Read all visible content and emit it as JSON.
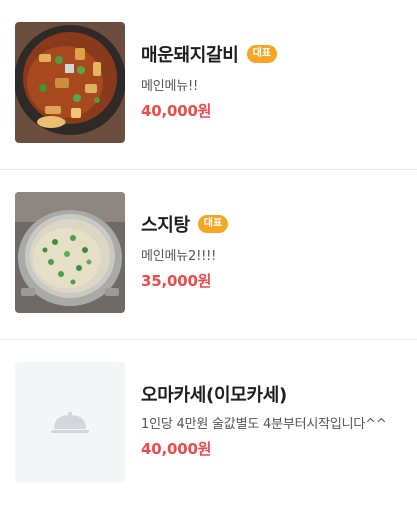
{
  "menu": {
    "items": [
      {
        "name": "매운돼지갈비",
        "badge": "대표",
        "description": "메인메뉴!!",
        "price": "40,000원",
        "image": "spicy-pork-rib-stew-photo"
      },
      {
        "name": "스지탕",
        "badge": "대표",
        "description": "메인메뉴2!!!!",
        "price": "35,000원",
        "image": "beef-tendon-soup-photo"
      },
      {
        "name": "오마카세(이모카세)",
        "description": "1인당 4만원 술값별도 4분부터시작입니다^^",
        "price": "40,000원",
        "image": "cloche-placeholder-icon"
      }
    ]
  },
  "colors": {
    "badge": "#f5a623",
    "price": "#f04a4a",
    "divider": "#ececec",
    "placeholder_bg": "#f4f5f7"
  }
}
